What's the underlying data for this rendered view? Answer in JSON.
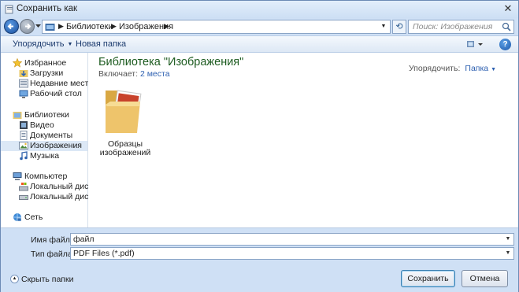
{
  "window": {
    "title": "Сохранить как",
    "close_glyph": "✕"
  },
  "address": {
    "crumbs": [
      "Библиотеки",
      "Изображения"
    ],
    "search_placeholder": "Поиск: Изображения"
  },
  "toolbar": {
    "organize_label": "Упорядочить",
    "new_folder_label": "Новая папка"
  },
  "navpane": {
    "favorites": {
      "label": "Избранное",
      "items": [
        "Загрузки",
        "Недавние места",
        "Рабочий стол"
      ]
    },
    "libraries": {
      "label": "Библиотеки",
      "items": [
        "Видео",
        "Документы",
        "Изображения",
        "Музыка"
      ],
      "selected": "Изображения"
    },
    "computer": {
      "label": "Компьютер",
      "items": [
        "Локальный диск (C:)",
        "Локальный диск (D:)"
      ]
    },
    "network": {
      "label": "Сеть"
    }
  },
  "content": {
    "library_title": "Библиотека \"Изображения\"",
    "includes_label": "Включает:",
    "includes_link": "2 места",
    "arrange_label": "Упорядочить:",
    "arrange_value": "Папка",
    "items": [
      {
        "label_line1": "Образцы",
        "label_line2": "изображений"
      }
    ]
  },
  "form": {
    "filename_label": "Имя файла:",
    "filename_value": "файл",
    "filetype_label": "Тип файла:",
    "filetype_value": "PDF Files (*.pdf)",
    "hide_folders_label": "Скрыть папки",
    "save_label": "Сохранить",
    "cancel_label": "Отмена"
  },
  "colors": {
    "title_green": "#1e5c21",
    "link_blue": "#2c5fb0",
    "chrome_blue": "#cfe0f5"
  }
}
